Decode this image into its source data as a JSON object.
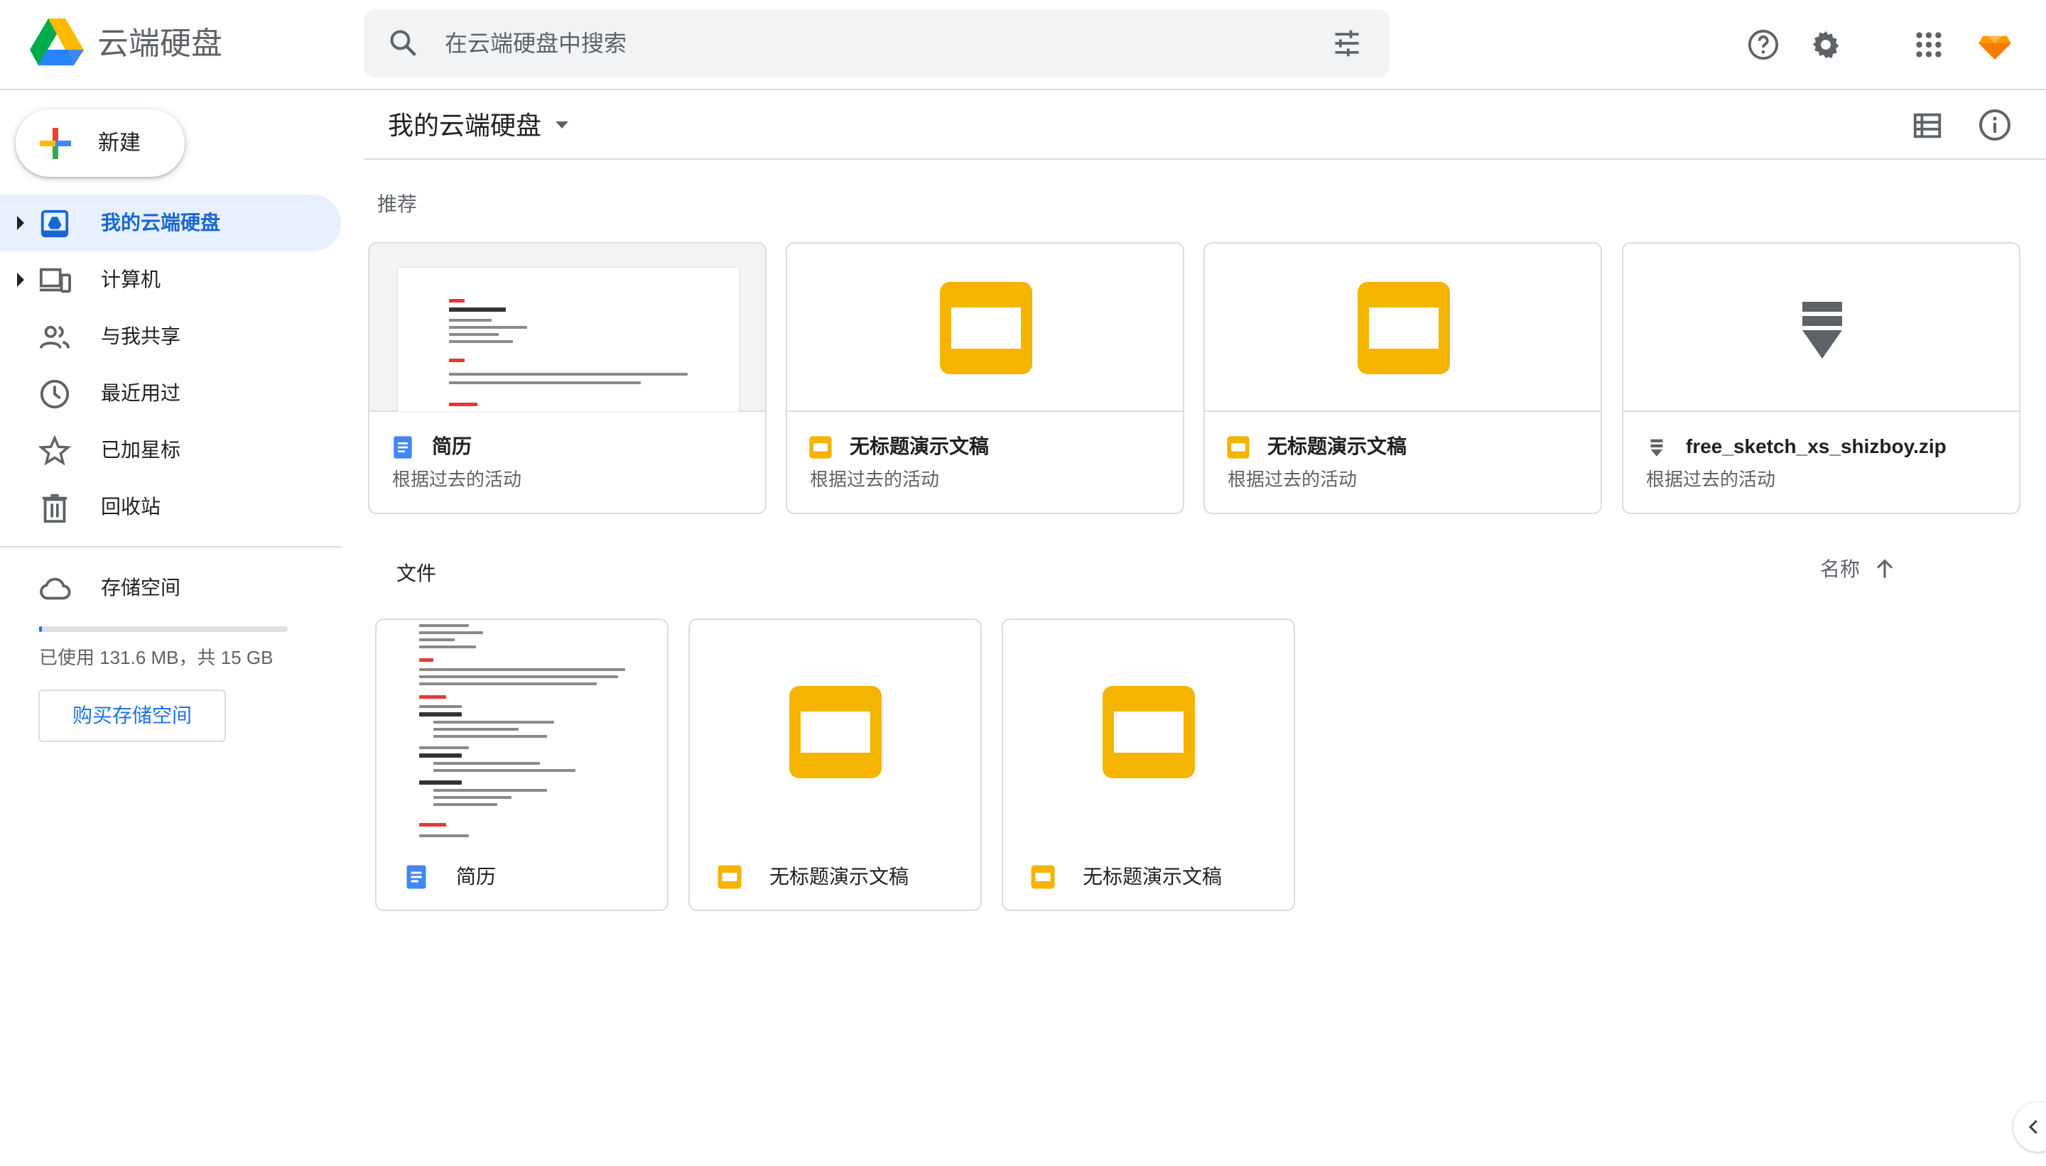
{
  "header": {
    "app_title": "云端硬盘",
    "search_placeholder": "在云端硬盘中搜索"
  },
  "sidebar": {
    "new_label": "新建",
    "items": [
      {
        "label": "我的云端硬盘",
        "active": true
      },
      {
        "label": "计算机"
      },
      {
        "label": "与我共享"
      },
      {
        "label": "最近用过"
      },
      {
        "label": "已加星标"
      },
      {
        "label": "回收站"
      }
    ],
    "storage": {
      "label": "存储空间",
      "usage_text": "已使用 131.6 MB，共 15 GB",
      "used_fraction": 0.0086,
      "buy_label": "购买存储空间"
    }
  },
  "main": {
    "breadcrumb": "我的云端硬盘",
    "recommended_title": "推荐",
    "recommended": [
      {
        "name": "简历",
        "subtitle": "根据过去的活动",
        "type": "doc"
      },
      {
        "name": "无标题演示文稿",
        "subtitle": "根据过去的活动",
        "type": "slides"
      },
      {
        "name": "无标题演示文稿",
        "subtitle": "根据过去的活动",
        "type": "slides"
      },
      {
        "name": "free_sketch_xs_shizboy.zip",
        "subtitle": "根据过去的活动",
        "type": "zip"
      }
    ],
    "files_title": "文件",
    "sort_label": "名称",
    "files": [
      {
        "name": "简历",
        "type": "doc"
      },
      {
        "name": "无标题演示文稿",
        "type": "slides"
      },
      {
        "name": "无标题演示文稿",
        "type": "slides"
      }
    ]
  },
  "colors": {
    "accent": "#1a73e8",
    "slides_yellow": "#f4b400",
    "docs_blue": "#4285f4",
    "active_bg": "#e8f0fe"
  },
  "icons": [
    "drive-logo-icon",
    "search-icon",
    "tune-icon",
    "help-icon",
    "settings-icon",
    "apps-grid-icon",
    "account-avatar-icon",
    "my-drive-icon",
    "computer-icon",
    "shared-icon",
    "recent-icon",
    "star-icon",
    "trash-icon",
    "cloud-icon",
    "list-view-icon",
    "info-icon",
    "arrow-up-icon",
    "chevron-left-icon"
  ]
}
